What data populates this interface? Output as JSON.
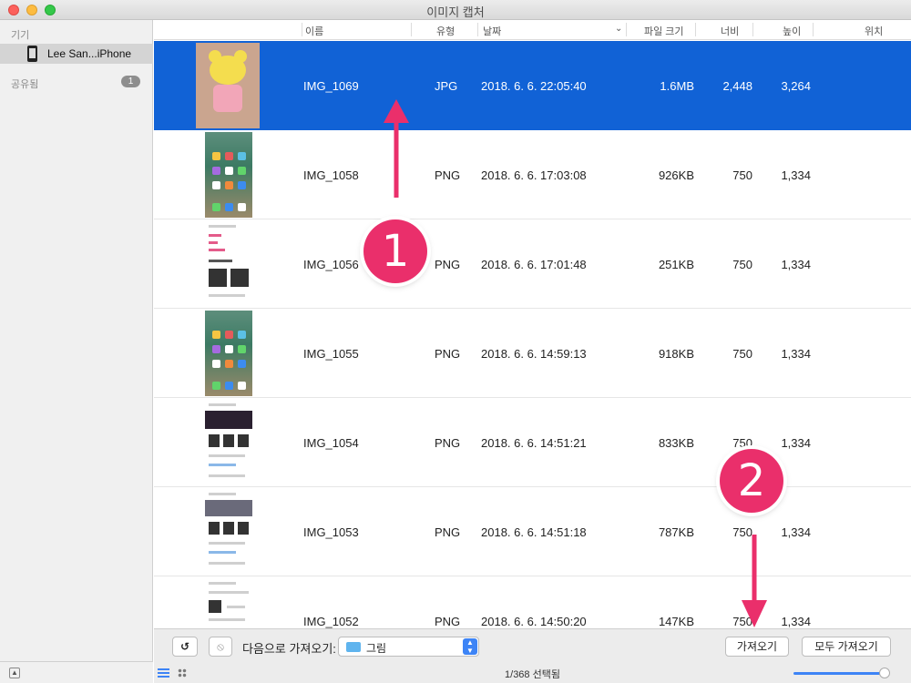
{
  "window": {
    "title": "이미지 캡처"
  },
  "sidebar": {
    "devices_header": "기기",
    "device_name": "Lee San...iPhone",
    "shared_header": "공유됨",
    "shared_count": "1"
  },
  "columns": {
    "name": "이름",
    "type": "유형",
    "date": "날짜",
    "size": "파일 크기",
    "width": "너비",
    "height": "높이",
    "location": "위치"
  },
  "rows": [
    {
      "name": "IMG_1069",
      "type": "JPG",
      "date": "2018. 6. 6. 22:05:40",
      "size": "1.6MB",
      "width": "2,448",
      "height": "3,264",
      "selected": true,
      "thumb": "bear-drawing"
    },
    {
      "name": "IMG_1058",
      "type": "PNG",
      "date": "2018. 6. 6. 17:03:08",
      "size": "926KB",
      "width": "750",
      "height": "1,334",
      "thumb": "home-screen"
    },
    {
      "name": "IMG_1056",
      "type": "PNG",
      "date": "2018. 6. 6. 17:01:48",
      "size": "251KB",
      "width": "750",
      "height": "1,334",
      "thumb": "web-page"
    },
    {
      "name": "IMG_1055",
      "type": "PNG",
      "date": "2018. 6. 6. 14:59:13",
      "size": "918KB",
      "width": "750",
      "height": "1,334",
      "thumb": "home-screen"
    },
    {
      "name": "IMG_1054",
      "type": "PNG",
      "date": "2018. 6. 6. 14:51:21",
      "size": "833KB",
      "width": "750",
      "height": "1,334",
      "thumb": "web-page"
    },
    {
      "name": "IMG_1053",
      "type": "PNG",
      "date": "2018. 6. 6. 14:51:18",
      "size": "787KB",
      "width": "750",
      "height": "1,334",
      "thumb": "web-page"
    },
    {
      "name": "IMG_1052",
      "type": "PNG",
      "date": "2018. 6. 6. 14:50:20",
      "size": "147KB",
      "width": "750",
      "height": "1,334",
      "thumb": "web-page"
    }
  ],
  "toolbar": {
    "import_to_label": "다음으로 가져오기:",
    "destination": "그림",
    "import_button": "가져오기",
    "import_all_button": "모두 가져오기"
  },
  "status": {
    "selection": "1/368 선택됨"
  },
  "annotations": {
    "marker1": "1",
    "marker2": "2",
    "color": "#ea2f6b"
  },
  "colors": {
    "selection": "#1162d6",
    "accent": "#3d84f6"
  }
}
